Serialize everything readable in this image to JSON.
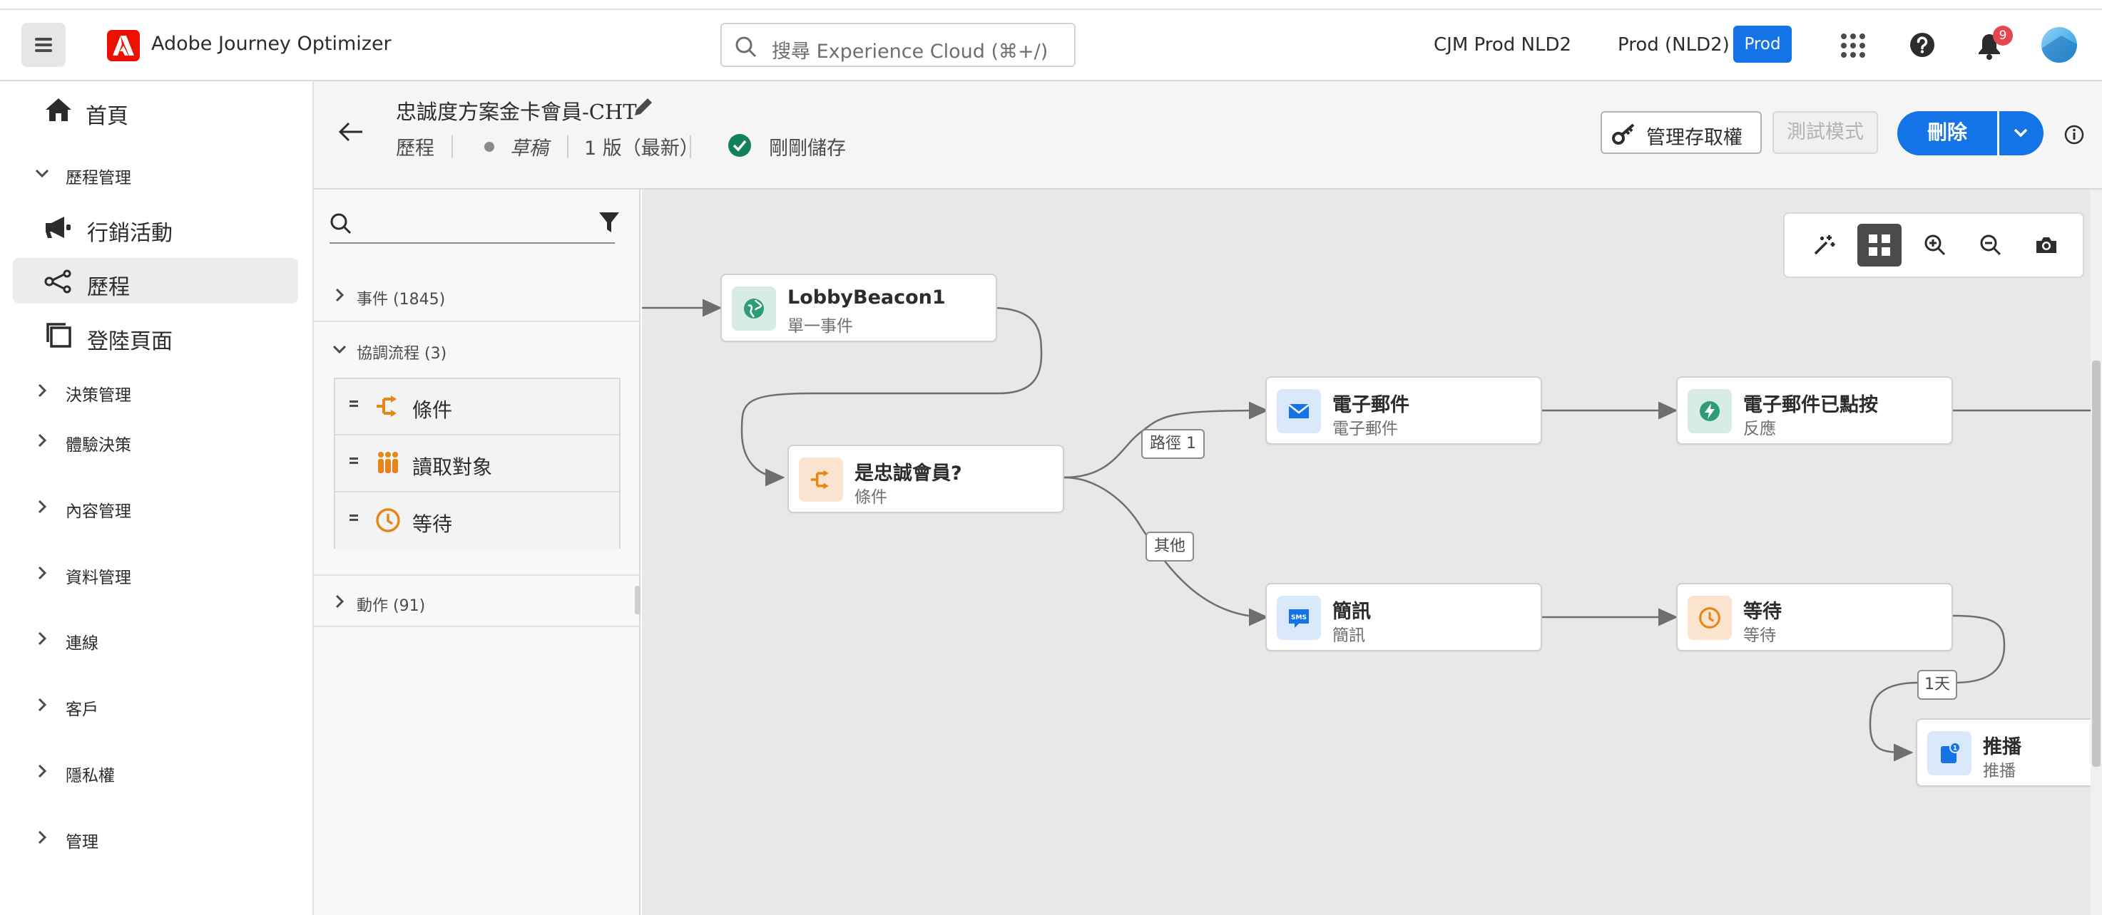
{
  "header": {
    "app_name": "Adobe Journey Optimizer",
    "search_placeholder": "搜尋 Experience Cloud (⌘+/)",
    "org_name": "CJM Prod NLD2",
    "sandbox_name": "Prod (NLD2)",
    "sandbox_badge": "Prod",
    "notification_count": "9"
  },
  "sidebar": {
    "home": "首頁",
    "journey_management": "歷程管理",
    "items": [
      {
        "label": "行銷活動",
        "icon": "megaphone-icon"
      },
      {
        "label": "歷程",
        "icon": "journey-icon"
      },
      {
        "label": "登陸頁面",
        "icon": "landing-page-icon"
      }
    ],
    "groups": [
      "決策管理",
      "體驗決策",
      "內容管理",
      "資料管理",
      "連線",
      "客戶",
      "隱私權",
      "管理"
    ]
  },
  "journey": {
    "title": "忠誠度方案金卡會員-CHT",
    "type": "歷程",
    "status": "草稿",
    "version": "1 版（最新）",
    "save_status": "剛剛儲存",
    "manage_access": "管理存取權",
    "test_mode": "測試模式",
    "delete": "刪除"
  },
  "palette": {
    "search_value": "",
    "sections": [
      {
        "label": "事件",
        "count": "(1845)"
      },
      {
        "label": "協調流程",
        "count": "(3)"
      },
      {
        "label": "動作",
        "count": "(91)"
      }
    ],
    "orchestration_items": [
      {
        "label": "條件",
        "icon": "condition-icon"
      },
      {
        "label": "讀取對象",
        "icon": "audience-icon"
      },
      {
        "label": "等待",
        "icon": "wait-icon"
      }
    ]
  },
  "canvas": {
    "nodes": {
      "event": {
        "title": "LobbyBeacon1",
        "subtitle": "單一事件"
      },
      "condition": {
        "title": "是忠誠會員?",
        "subtitle": "條件"
      },
      "email": {
        "title": "電子郵件",
        "subtitle": "電子郵件"
      },
      "email_clicked": {
        "title": "電子郵件已點按",
        "subtitle": "反應"
      },
      "sms": {
        "title": "簡訊",
        "subtitle": "簡訊"
      },
      "wait": {
        "title": "等待",
        "subtitle": "等待"
      },
      "push": {
        "title": "推播",
        "subtitle": "推播"
      }
    },
    "edge_labels": {
      "path1": "路徑 1",
      "other": "其他",
      "one_day": "1天"
    }
  },
  "colors": {
    "accent": "#1473e6",
    "adobe_red": "#eb1000",
    "orange": "#e68619",
    "green": "#2d9d78"
  }
}
